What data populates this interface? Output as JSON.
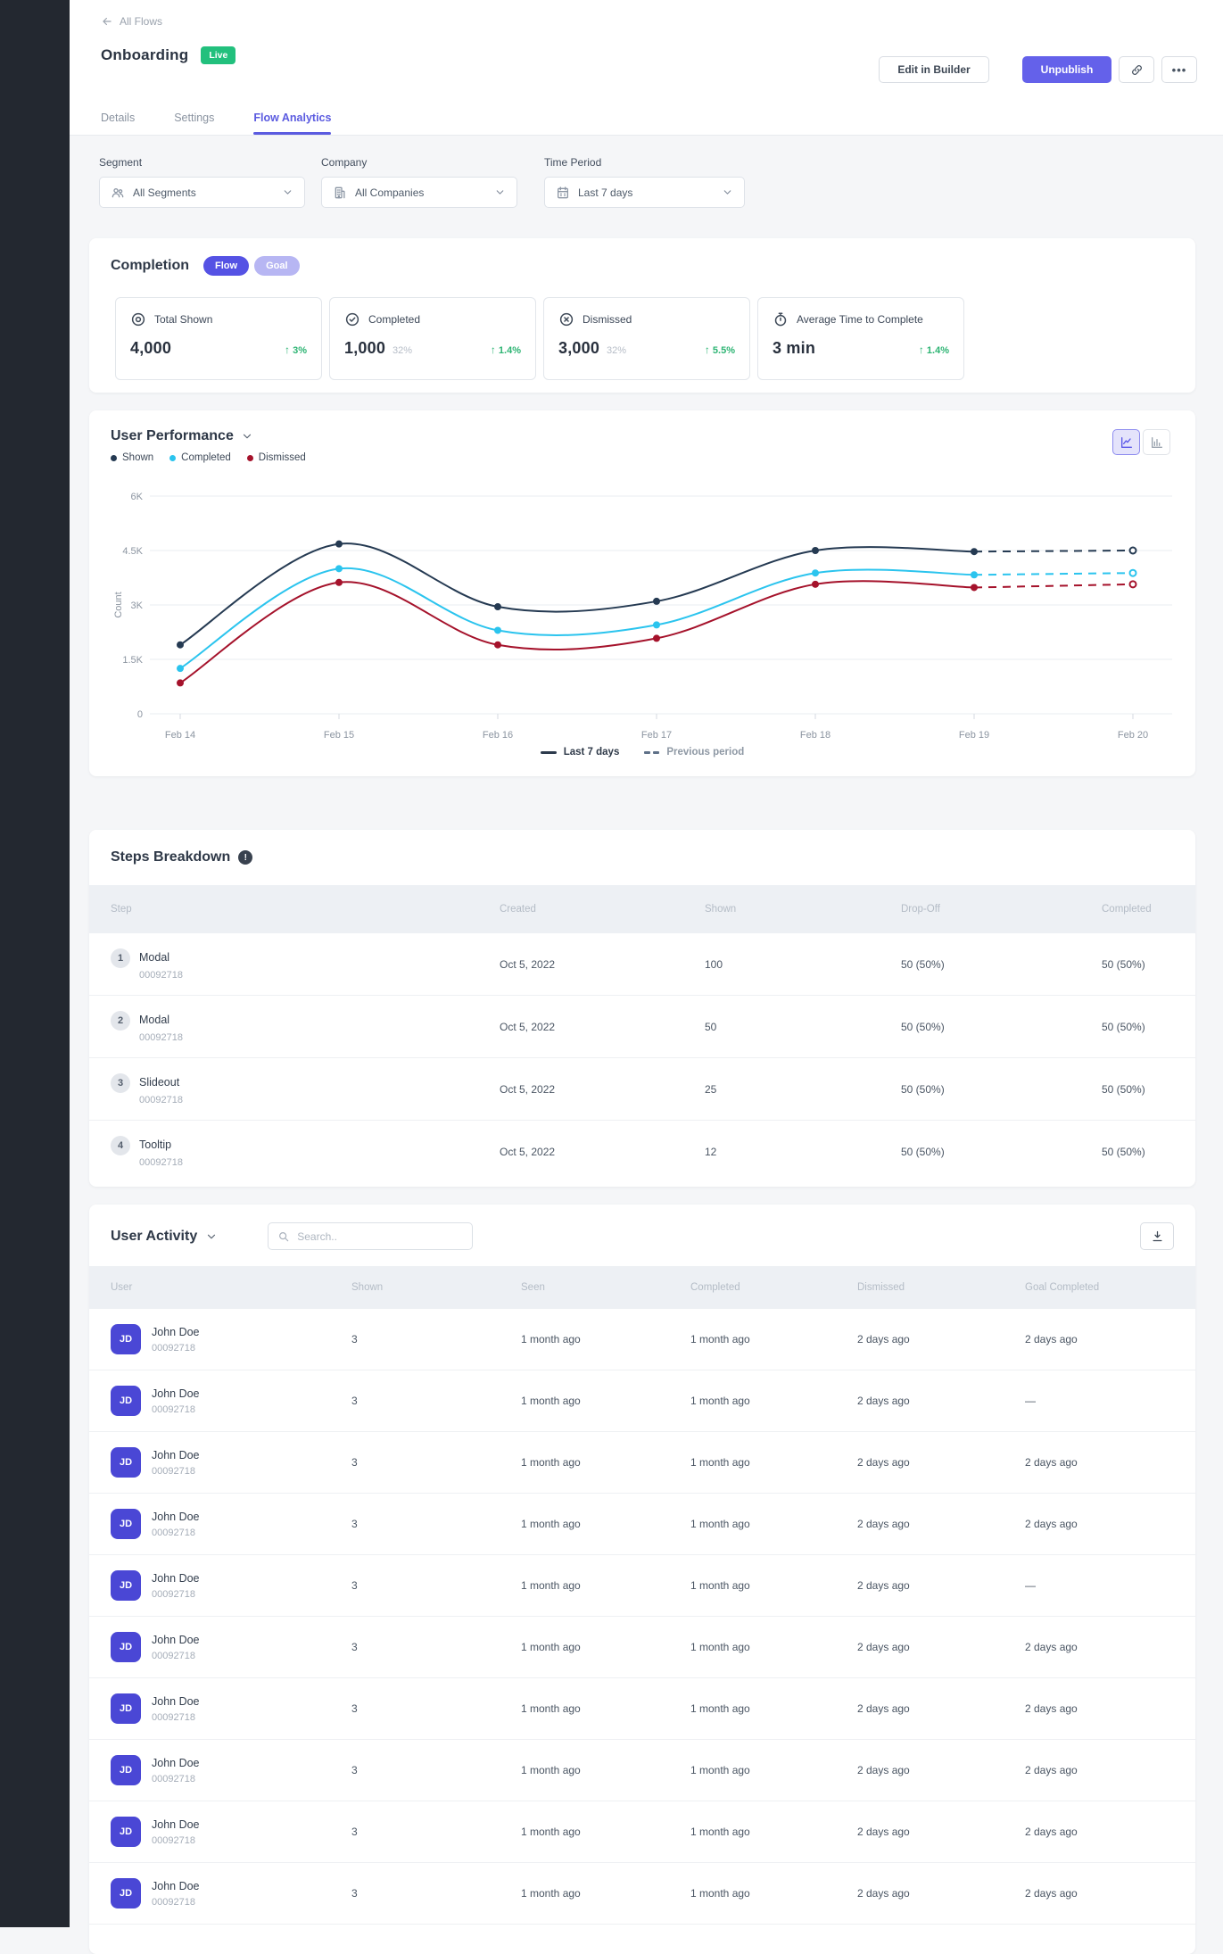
{
  "nav": {
    "back_label": "All Flows"
  },
  "header": {
    "title": "Onboarding",
    "status_badge": "Live",
    "edit_label": "Edit in Builder",
    "unpublish_label": "Unpublish",
    "more_label": "•••"
  },
  "tabs": [
    {
      "label": "Details",
      "active": false
    },
    {
      "label": "Settings",
      "active": false
    },
    {
      "label": "Flow Analytics",
      "active": true
    }
  ],
  "filters": [
    {
      "label": "Segment",
      "value": "All Segments",
      "icon": "users-icon"
    },
    {
      "label": "Company",
      "value": "All Companies",
      "icon": "building-icon"
    },
    {
      "label": "Time Period",
      "value": "Last 7 days",
      "icon": "calendar-icon"
    }
  ],
  "completion": {
    "title": "Completion",
    "toggles": [
      {
        "label": "Flow",
        "active": true
      },
      {
        "label": "Goal",
        "active": false
      }
    ],
    "stats": [
      {
        "icon": "eye-icon",
        "label": "Total Shown",
        "value": "4,000",
        "sub": "",
        "delta": "3%"
      },
      {
        "icon": "check-circle-icon",
        "label": "Completed",
        "value": "1,000",
        "sub": "32%",
        "delta": "1.4%"
      },
      {
        "icon": "x-circle-icon",
        "label": "Dismissed",
        "value": "3,000",
        "sub": "32%",
        "delta": "5.5%"
      },
      {
        "icon": "stopwatch-icon",
        "label": "Average Time to Complete",
        "value": "3 min",
        "sub": "",
        "delta": "1.4%"
      }
    ]
  },
  "chart_data": {
    "type": "line",
    "title": "User Performance",
    "ylabel": "Count",
    "x": [
      "Feb 14",
      "Feb 15",
      "Feb 16",
      "Feb 17",
      "Feb 18",
      "Feb 19",
      "Feb 20"
    ],
    "yticks": [
      "0",
      "1.5K",
      "3K",
      "4.5K",
      "6K"
    ],
    "ylim": [
      0,
      6000
    ],
    "series": [
      {
        "name": "Shown",
        "color": "#253a52",
        "values": [
          1900,
          4680,
          2950,
          3100,
          4500,
          4470,
          4500
        ]
      },
      {
        "name": "Completed",
        "color": "#2bc4ee",
        "values": [
          1250,
          4000,
          2300,
          2450,
          3880,
          3830,
          3880
        ]
      },
      {
        "name": "Dismissed",
        "color": "#a5122b",
        "values": [
          850,
          3620,
          1900,
          2080,
          3570,
          3480,
          3570
        ]
      }
    ],
    "dashed_from_index": 5,
    "grid": true,
    "legend_position": "top-left",
    "legend_bottom": [
      {
        "label": "Last 7 days",
        "style": "solid"
      },
      {
        "label": "Previous period",
        "style": "dashed"
      }
    ]
  },
  "steps": {
    "title": "Steps Breakdown",
    "columns": [
      "Step",
      "Created",
      "Shown",
      "Drop-Off",
      "Completed"
    ],
    "rows": [
      {
        "num": "1",
        "type": "Modal",
        "id": "00092718",
        "created": "Oct 5, 2022",
        "shown": "100",
        "dropoff": "50 (50%)",
        "completed": "50 (50%)"
      },
      {
        "num": "2",
        "type": "Modal",
        "id": "00092718",
        "created": "Oct 5, 2022",
        "shown": "50",
        "dropoff": "50 (50%)",
        "completed": "50 (50%)"
      },
      {
        "num": "3",
        "type": "Slideout",
        "id": "00092718",
        "created": "Oct 5, 2022",
        "shown": "25",
        "dropoff": "50 (50%)",
        "completed": "50 (50%)"
      },
      {
        "num": "4",
        "type": "Tooltip",
        "id": "00092718",
        "created": "Oct 5, 2022",
        "shown": "12",
        "dropoff": "50 (50%)",
        "completed": "50 (50%)"
      }
    ]
  },
  "activity": {
    "title": "User Activity",
    "search_placeholder": "Search..",
    "columns": [
      "User",
      "Shown",
      "Seen",
      "Completed",
      "Dismissed",
      "Goal Completed"
    ],
    "rows": [
      {
        "initials": "JD",
        "name": "John Doe",
        "id": "00092718",
        "shown": "3",
        "seen": "1 month ago",
        "completed": "1 month ago",
        "dismissed": "2 days ago",
        "goal": "2 days ago"
      },
      {
        "initials": "JD",
        "name": "John Doe",
        "id": "00092718",
        "shown": "3",
        "seen": "1 month ago",
        "completed": "1 month ago",
        "dismissed": "2 days ago",
        "goal": "—"
      },
      {
        "initials": "JD",
        "name": "John Doe",
        "id": "00092718",
        "shown": "3",
        "seen": "1 month ago",
        "completed": "1 month ago",
        "dismissed": "2 days ago",
        "goal": "2 days ago"
      },
      {
        "initials": "JD",
        "name": "John Doe",
        "id": "00092718",
        "shown": "3",
        "seen": "1 month ago",
        "completed": "1 month ago",
        "dismissed": "2 days ago",
        "goal": "2 days ago"
      },
      {
        "initials": "JD",
        "name": "John Doe",
        "id": "00092718",
        "shown": "3",
        "seen": "1 month ago",
        "completed": "1 month ago",
        "dismissed": "2 days ago",
        "goal": "—"
      },
      {
        "initials": "JD",
        "name": "John Doe",
        "id": "00092718",
        "shown": "3",
        "seen": "1 month ago",
        "completed": "1 month ago",
        "dismissed": "2 days ago",
        "goal": "2 days ago"
      },
      {
        "initials": "JD",
        "name": "John Doe",
        "id": "00092718",
        "shown": "3",
        "seen": "1 month ago",
        "completed": "1 month ago",
        "dismissed": "2 days ago",
        "goal": "2 days ago"
      },
      {
        "initials": "JD",
        "name": "John Doe",
        "id": "00092718",
        "shown": "3",
        "seen": "1 month ago",
        "completed": "1 month ago",
        "dismissed": "2 days ago",
        "goal": "2 days ago"
      },
      {
        "initials": "JD",
        "name": "John Doe",
        "id": "00092718",
        "shown": "3",
        "seen": "1 month ago",
        "completed": "1 month ago",
        "dismissed": "2 days ago",
        "goal": "2 days ago"
      },
      {
        "initials": "JD",
        "name": "John Doe",
        "id": "00092718",
        "shown": "3",
        "seen": "1 month ago",
        "completed": "1 month ago",
        "dismissed": "2 days ago",
        "goal": "2 days ago"
      }
    ]
  },
  "colors": {
    "accent": "#5b5be0",
    "accent_button": "#6461ea",
    "live_green": "#22c07d",
    "delta_green": "#2db473",
    "sidebar": "#232830",
    "avatar": "#4a47d5"
  }
}
